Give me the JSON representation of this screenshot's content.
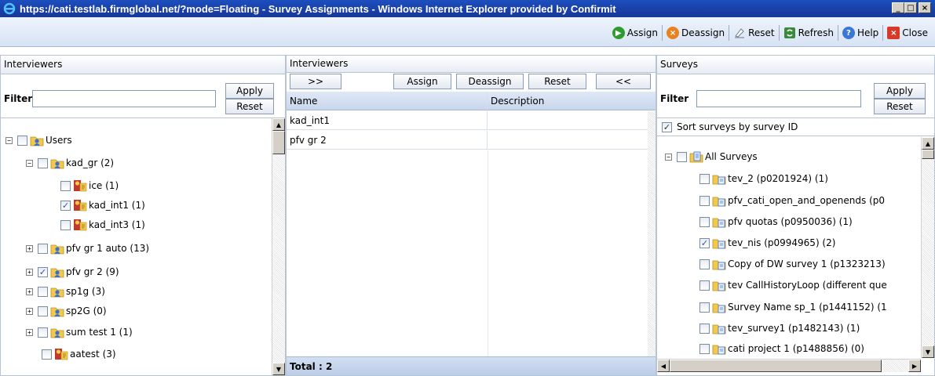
{
  "window": {
    "title": "https://cati.testlab.firmglobal.net/?mode=Floating - Survey Assignments - Windows Internet Explorer provided by Confirmit",
    "minimize": "_",
    "maximize": "□",
    "close": "×"
  },
  "toolbar": {
    "assign": "Assign",
    "deassign": "Deassign",
    "reset": "Reset",
    "refresh": "Refresh",
    "help": "Help",
    "close": "Close"
  },
  "left_panel": {
    "header": "Interviewers",
    "filter_label": "Filter",
    "filter_value": "",
    "apply": "Apply",
    "reset": "Reset",
    "tree": [
      {
        "label": "Users",
        "expander": "−",
        "checked": false,
        "icon": "user-folder-icon"
      },
      {
        "label": "kad_gr (2)",
        "expander": "−",
        "checked": false,
        "icon": "user-folder-icon"
      },
      {
        "label": "ice (1)",
        "expander": "",
        "checked": false,
        "icon": "interviewer-icon"
      },
      {
        "label": "kad_int1 (1)",
        "expander": "",
        "checked": true,
        "icon": "interviewer-icon"
      },
      {
        "label": "kad_int3 (1)",
        "expander": "",
        "checked": false,
        "icon": "interviewer-icon"
      },
      {
        "label": "pfv gr 1 auto (13)",
        "expander": "+",
        "checked": false,
        "icon": "user-folder-icon"
      },
      {
        "label": "pfv gr 2 (9)",
        "expander": "+",
        "checked": true,
        "icon": "user-folder-icon"
      },
      {
        "label": "sp1g (3)",
        "expander": "+",
        "checked": false,
        "icon": "user-folder-icon"
      },
      {
        "label": "sp2G (0)",
        "expander": "+",
        "checked": false,
        "icon": "user-folder-icon"
      },
      {
        "label": "sum test 1 (1)",
        "expander": "+",
        "checked": false,
        "icon": "user-folder-icon"
      },
      {
        "label": "aatest (3)",
        "expander": "",
        "checked": false,
        "icon": "interviewer-icon"
      }
    ]
  },
  "middle_panel": {
    "header": "Interviewers",
    "btn_add_all": ">>",
    "btn_assign": "Assign",
    "btn_deassign": "Deassign",
    "btn_reset": "Reset",
    "btn_remove_all": "<<",
    "columns": [
      "Name",
      "Description"
    ],
    "rows": [
      {
        "name": "kad_int1",
        "description": ""
      },
      {
        "name": "pfv gr 2",
        "description": ""
      }
    ],
    "total": "Total : 2"
  },
  "right_panel": {
    "header": "Surveys",
    "filter_label": "Filter",
    "filter_value": "",
    "apply": "Apply",
    "reset": "Reset",
    "sort_label": "Sort surveys by survey ID",
    "sort_checked": true,
    "tree": [
      {
        "label": "All Surveys",
        "expander": "−",
        "checked": false,
        "icon": "surveys-folder-icon"
      },
      {
        "label": "tev_2 (p0201924) (1)",
        "checked": false,
        "icon": "survey-icon"
      },
      {
        "label": "pfv_cati_open_and_openends (p0",
        "checked": false,
        "icon": "survey-icon"
      },
      {
        "label": "pfv quotas (p0950036) (1)",
        "checked": false,
        "icon": "survey-icon"
      },
      {
        "label": "tev_nis (p0994965) (2)",
        "checked": true,
        "icon": "survey-icon"
      },
      {
        "label": "Copy of DW survey 1 (p1323213)",
        "checked": false,
        "icon": "survey-icon"
      },
      {
        "label": "tev CallHistoryLoop (different que",
        "checked": false,
        "icon": "survey-icon"
      },
      {
        "label": "Survey Name sp_1 (p1441152) (1",
        "checked": false,
        "icon": "survey-icon"
      },
      {
        "label": "tev_survey1 (p1482143) (1)",
        "checked": false,
        "icon": "survey-icon"
      },
      {
        "label": "cati project 1 (p1488856) (0)",
        "checked": false,
        "icon": "survey-icon"
      }
    ]
  },
  "colors": {
    "titlebar": "#1a3fa6",
    "panel_border": "#b8c4d4",
    "assign_green": "#2e9b2e",
    "deassign_orange": "#e8821e",
    "help_blue": "#3a78d8",
    "close_red": "#d83a2a"
  }
}
